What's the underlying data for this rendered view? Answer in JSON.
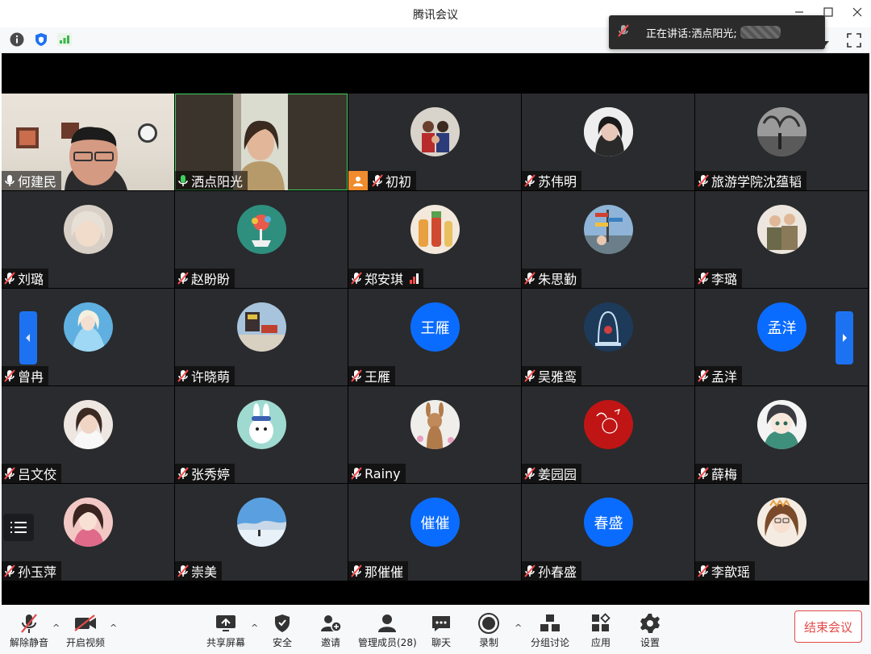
{
  "window": {
    "title": "腾讯会议"
  },
  "speaker": {
    "prefix": "正在讲话: ",
    "name": "洒点阳光;"
  },
  "participants": [
    {
      "name": "何建民",
      "mic": "on",
      "type": "camera",
      "bg": "#c9b7a0"
    },
    {
      "name": "洒点阳光",
      "mic": "active",
      "type": "camera",
      "bg": "#b7a68a"
    },
    {
      "name": "初初",
      "mic": "muted",
      "type": "photo",
      "bg": "#7a5a4a",
      "host": true
    },
    {
      "name": "苏伟明",
      "mic": "muted",
      "type": "photo",
      "bg": "#3b3836"
    },
    {
      "name": "旅游学院沈蕴韬",
      "mic": "muted",
      "type": "photo",
      "bg": "#777777"
    },
    {
      "name": "刘璐",
      "mic": "muted",
      "type": "photo",
      "bg": "#d7c7b8"
    },
    {
      "name": "赵盼盼",
      "mic": "muted",
      "type": "photo",
      "bg": "#2f8f7f"
    },
    {
      "name": "郑安琪",
      "mic": "muted",
      "type": "photo",
      "bg": "#e5cdb5",
      "signal": true
    },
    {
      "name": "朱思勤",
      "mic": "muted",
      "type": "photo",
      "bg": "#7fa4c9"
    },
    {
      "name": "李璐",
      "mic": "muted",
      "type": "photo",
      "bg": "#c4ad91"
    },
    {
      "name": "曾冉",
      "mic": "muted",
      "type": "photo",
      "bg": "#7fc0e6"
    },
    {
      "name": "许晓萌",
      "mic": "muted",
      "type": "photo",
      "bg": "#9fb7cc"
    },
    {
      "name": "王雁",
      "mic": "muted",
      "type": "text",
      "initials": "王雁"
    },
    {
      "name": "吴雅鸾",
      "mic": "muted",
      "type": "photo",
      "bg": "#2a4a6a"
    },
    {
      "name": "孟洋",
      "mic": "muted",
      "type": "text",
      "initials": "孟洋"
    },
    {
      "name": "吕文佼",
      "mic": "muted",
      "type": "photo",
      "bg": "#e2d6cf"
    },
    {
      "name": "张秀婷",
      "mic": "muted",
      "type": "photo",
      "bg": "#9fdad0"
    },
    {
      "name": "Rainy",
      "mic": "muted",
      "type": "photo",
      "bg": "#d9c5b3"
    },
    {
      "name": "姜园园",
      "mic": "muted",
      "type": "photo",
      "bg": "#c01515"
    },
    {
      "name": "薛梅",
      "mic": "muted",
      "type": "photo",
      "bg": "#3e8f7c"
    },
    {
      "name": "孙玉萍",
      "mic": "muted",
      "type": "photo",
      "bg": "#e9b9b4"
    },
    {
      "name": "崇美",
      "mic": "muted",
      "type": "photo",
      "bg": "#8ec1ea"
    },
    {
      "name": "那催催",
      "mic": "muted",
      "type": "text",
      "initials": "催催"
    },
    {
      "name": "孙春盛",
      "mic": "muted",
      "type": "text",
      "initials": "春盛"
    },
    {
      "name": "李歆瑶",
      "mic": "muted",
      "type": "photo",
      "bg": "#e8c9a4"
    }
  ],
  "toolbar": {
    "unmute": "解除静音",
    "start_video": "开启视频",
    "share_screen": "共享屏幕",
    "security": "安全",
    "invite": "邀请",
    "manage_members": "管理成员(28)",
    "chat": "聊天",
    "record": "录制",
    "breakout": "分组讨论",
    "apps": "应用",
    "settings": "设置",
    "end_meeting": "结束会议"
  },
  "colors": {
    "accent": "#0a6cff",
    "active_speaker": "#3fcf5c",
    "end": "#e34b4b",
    "muted": "#ff4a4a"
  }
}
